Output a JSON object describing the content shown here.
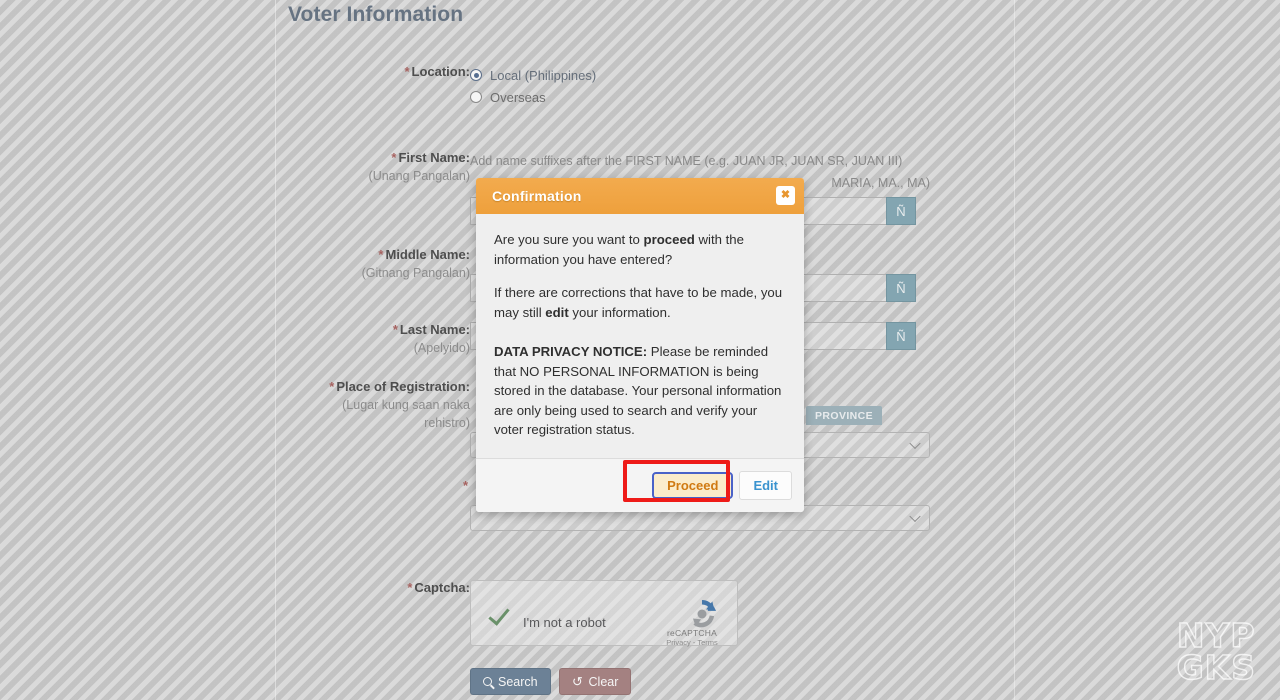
{
  "page": {
    "title": "Voter Information",
    "hint_suffix": "Add name suffixes after the FIRST NAME (e.g. JUAN JR, JUAN SR, JUAN III)",
    "hint_maria": "MARIA, MA., MA)",
    "enye_label": "Ñ"
  },
  "fields": {
    "location": {
      "label": "Location:",
      "required": "*",
      "options": [
        {
          "label": "Local (Philippines)",
          "checked": true
        },
        {
          "label": "Overseas",
          "checked": false
        }
      ]
    },
    "first_name": {
      "label": "First Name:",
      "sub": "(Unang Pangalan)",
      "required": "*",
      "value": ""
    },
    "middle_name": {
      "label": "Middle Name:",
      "sub": "(Gitnang Pangalan)",
      "required": "*",
      "value": ""
    },
    "last_name": {
      "label": "Last Name:",
      "sub": "(Apelyido)",
      "required": "*",
      "value": ""
    },
    "place_of_registration": {
      "label": "Place of Registration:",
      "sub_line1": "(Lugar kung saan naka",
      "sub_line2": "rehistro)",
      "required": "*",
      "tab_province": "PROVINCE",
      "select_province_value": "",
      "select_city_value": ""
    },
    "captcha": {
      "label": "Captcha:",
      "required": "*",
      "checkbox_label": "I'm not a robot",
      "brand": "reCAPTCHA",
      "links": "Privacy - Terms",
      "checked": true
    }
  },
  "actions": {
    "search_label": "Search",
    "clear_label": "Clear",
    "search_icon": "magnifier-icon",
    "clear_icon": "undo-icon"
  },
  "modal": {
    "title": "Confirmation",
    "close_glyph": "✖",
    "paragraph_1_pre": "Are you sure you want to ",
    "paragraph_1_bold": "proceed",
    "paragraph_1_post": " with the information you have entered?",
    "paragraph_2_pre": "If there are corrections that have to be made, you may still ",
    "paragraph_2_bold": "edit",
    "paragraph_2_post": " your information.",
    "paragraph_3_bold": "DATA PRIVACY NOTICE:",
    "paragraph_3_rest": " Please be reminded that NO PERSONAL INFORMATION is being stored in the database. Your personal information are only being used to search and verify your voter registration status.",
    "proceed_label": "Proceed",
    "edit_label": "Edit"
  },
  "watermark": {
    "line1": "NYP",
    "line2": "GKS"
  },
  "colors": {
    "modal_header": "#efa03c",
    "title_blue": "#5a7391",
    "required_red": "#d9534f",
    "enye_teal": "#6aaec6",
    "search_blue": "#5a84ad",
    "clear_red": "#c07a7a",
    "annotation_red": "#ee1b18",
    "proceed_text": "#d07a12",
    "edit_text": "#3a93cf"
  }
}
